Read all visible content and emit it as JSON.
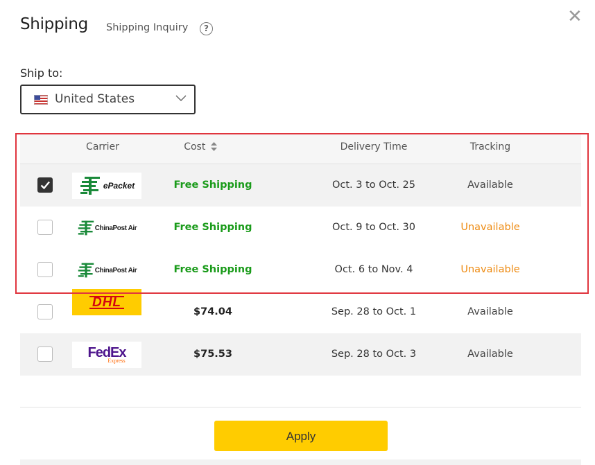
{
  "header": {
    "title": "Shipping",
    "inquiry_link": "Shipping Inquiry",
    "help_icon": "?",
    "close_icon": "✕"
  },
  "ship_to": {
    "label": "Ship to:",
    "selected": "United States"
  },
  "table": {
    "columns": {
      "carrier": "Carrier",
      "cost": "Cost",
      "delivery": "Delivery Time",
      "tracking": "Tracking"
    },
    "rows": [
      {
        "checked": true,
        "carrier": "ePacket",
        "logo_text": "ePacket",
        "cost": "Free Shipping",
        "delivery": "Oct. 3 to Oct. 25",
        "tracking": "Available"
      },
      {
        "checked": false,
        "carrier": "China Post Air",
        "logo_text": "ChinaPost Air",
        "cost": "Free Shipping",
        "delivery": "Oct. 9 to Oct. 30",
        "tracking": "Unavailable"
      },
      {
        "checked": false,
        "carrier": "China Post Air",
        "logo_text": "ChinaPost Air",
        "cost": "Free Shipping",
        "delivery": "Oct. 6 to Nov. 4",
        "tracking": "Unavailable"
      },
      {
        "checked": false,
        "carrier": "DHL",
        "logo_text": "DHL",
        "cost": "$74.04",
        "delivery": "Sep. 28 to Oct. 1",
        "tracking": "Available"
      },
      {
        "checked": false,
        "carrier": "FedEx",
        "logo_text": "FedEx",
        "logo_sub": "Express",
        "cost": "$75.53",
        "delivery": "Sep. 28 to Oct. 3",
        "tracking": "Available"
      }
    ]
  },
  "apply_button": "Apply",
  "colors": {
    "accent": "#ffcc00",
    "free": "#1a9b1a",
    "unavailable": "#ee8b12",
    "highlight": "#e0353e"
  }
}
